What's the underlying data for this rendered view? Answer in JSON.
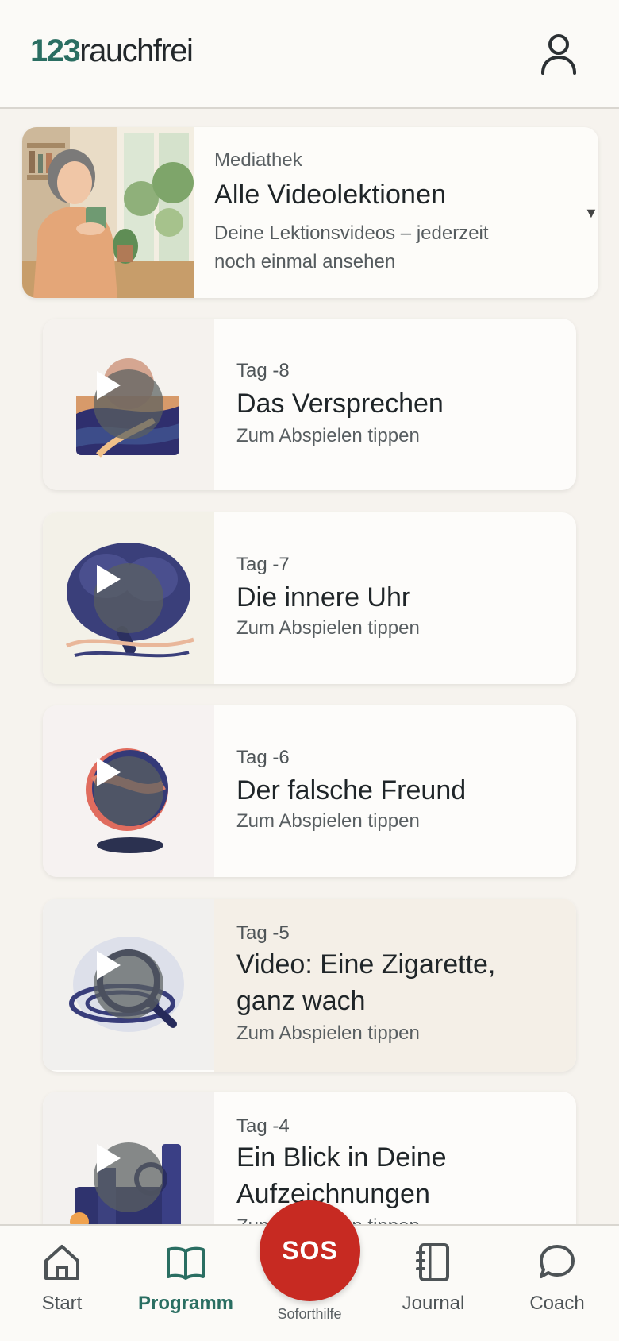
{
  "header": {
    "logo_number": "123",
    "logo_word": "rauchfrei",
    "profile_icon": "user-icon"
  },
  "hero": {
    "eyebrow": "Mediathek",
    "title": "Alle Videolektionen",
    "description": "Deine Lektionsvideos – jederzeit noch einmal ansehen",
    "chevron": "▼"
  },
  "cards": [
    {
      "day": "Tag -8",
      "title": "Das Versprechen",
      "subtitle": "Zum Abspielen tippen"
    },
    {
      "day": "Tag -7",
      "title": "Die innere Uhr",
      "subtitle": "Zum Abspielen tippen"
    },
    {
      "day": "Tag -6",
      "title": "Der falsche Freund",
      "subtitle": "Zum Abspielen tippen"
    },
    {
      "day": "Tag -5",
      "title": "Video: Eine Zigarette, ganz wach",
      "subtitle": "Zum Abspielen tippen"
    },
    {
      "day": "Tag -4",
      "title": "Ein Blick in Deine Aufzeichnungen",
      "subtitle": "Zum Abspielen tippen"
    }
  ],
  "nav": {
    "items": [
      {
        "label": "Start",
        "icon": "home-icon"
      },
      {
        "label": "Programm",
        "icon": "book-icon",
        "active": true
      },
      {
        "label": "Journal",
        "icon": "notebook-icon"
      },
      {
        "label": "Coach",
        "icon": "chat-icon"
      }
    ],
    "sos_label": "SOS",
    "sos_caption": "Soforthilfe"
  },
  "colors": {
    "accent": "#2a6e62",
    "sos": "#c72a22",
    "background": "#f6f3ee"
  }
}
